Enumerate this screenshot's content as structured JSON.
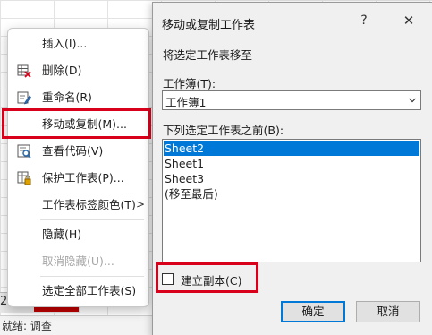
{
  "status_bar": {
    "text": "就绪: 调查"
  },
  "sheet_tab_number": "2",
  "context_menu": {
    "items": [
      {
        "label": "插入(I)...",
        "icon": "none",
        "disabled": false
      },
      {
        "label": "删除(D)",
        "icon": "delete-sheet-icon",
        "disabled": false
      },
      {
        "label": "重命名(R)",
        "icon": "rename-icon",
        "disabled": false
      },
      {
        "label": "移动或复制(M)...",
        "icon": "none",
        "disabled": false,
        "highlighted": true
      },
      {
        "label": "查看代码(V)",
        "icon": "view-code-icon",
        "disabled": false
      },
      {
        "label": "保护工作表(P)...",
        "icon": "protect-sheet-icon",
        "disabled": false
      },
      {
        "label": "工作表标签颜色(T)",
        "icon": "none",
        "disabled": false,
        "submenu_arrow": ">"
      },
      {
        "label": "隐藏(H)",
        "icon": "none",
        "disabled": false
      },
      {
        "label": "取消隐藏(U)...",
        "icon": "none",
        "disabled": true
      },
      {
        "label": "选定全部工作表(S)",
        "icon": "none",
        "disabled": false
      }
    ]
  },
  "dialog": {
    "title": "移动或复制工作表",
    "help": "?",
    "close": "✕",
    "move_selected_label": "将选定工作表移至",
    "workbook_label": "工作簿(T):",
    "workbook_value": "工作簿1",
    "before_sheet_label": "下列选定工作表之前(B):",
    "sheets": [
      {
        "name": "Sheet2",
        "selected": true
      },
      {
        "name": "Sheet1",
        "selected": false
      },
      {
        "name": "Sheet3",
        "selected": false
      },
      {
        "name": "(移至最后)",
        "selected": false
      }
    ],
    "create_copy_label": "建立副本(C)",
    "create_copy_checked": false,
    "ok_label": "确定",
    "cancel_label": "取消"
  },
  "colors": {
    "highlight_red": "#d9001b",
    "selection_blue": "#0078d7"
  }
}
